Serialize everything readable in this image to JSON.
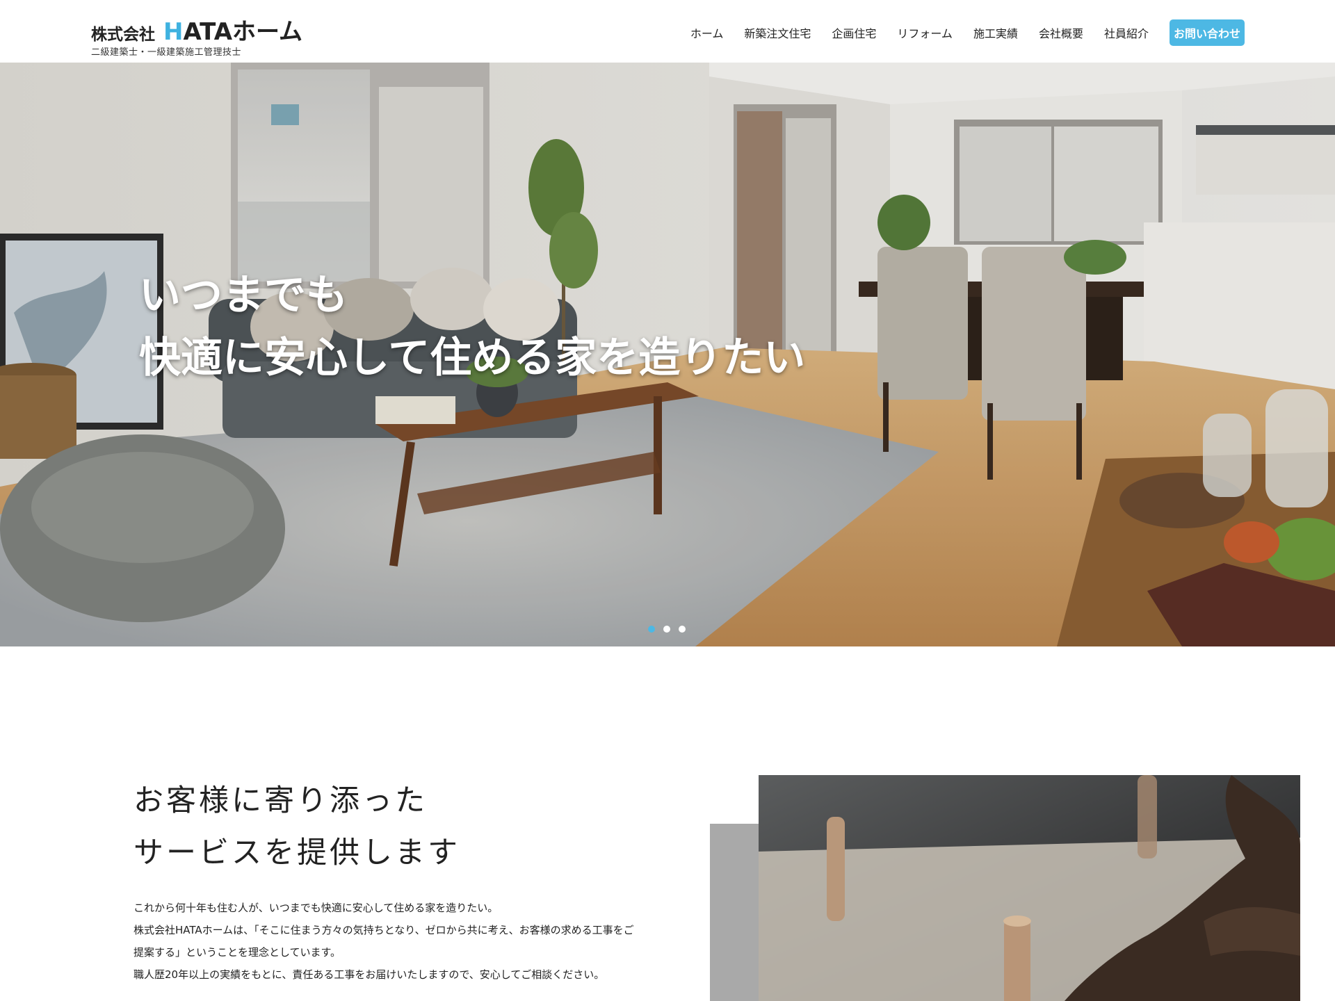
{
  "logo": {
    "company_prefix": "株式会社",
    "name_accent": "H",
    "name_rest": "ATAホーム",
    "subtitle": "二級建築士・一級建築施工管理技士",
    "accent_color": "#3fb2e0"
  },
  "nav": {
    "items": [
      {
        "label": "ホーム"
      },
      {
        "label": "新築注文住宅"
      },
      {
        "label": "企画住宅"
      },
      {
        "label": "リフォーム"
      },
      {
        "label": "施工実績"
      },
      {
        "label": "会社概要"
      },
      {
        "label": "社員紹介"
      }
    ],
    "cta_label": "お問い合わせ",
    "cta_color": "#4db8e4"
  },
  "hero": {
    "line1": "いつまでも",
    "line2": "快適に安心して住める家を造りたい",
    "slide_count": 3,
    "active_slide": 1
  },
  "about": {
    "title_line1": "お客様に寄り添った",
    "title_line2": "サービスを提供します",
    "paragraph": [
      "これから何十年も住む人が、いつまでも快適に安心して住める家を造りたい。",
      "株式会社HATAホームは、「そこに住まう方々の気持ちとなり、ゼロから共に考え、お客様の求める工事をご",
      "提案する」ということを理念としています。",
      "職人歴20年以上の実績をもとに、責任ある工事をお届けいたしますので、安心してご相談ください。"
    ]
  }
}
